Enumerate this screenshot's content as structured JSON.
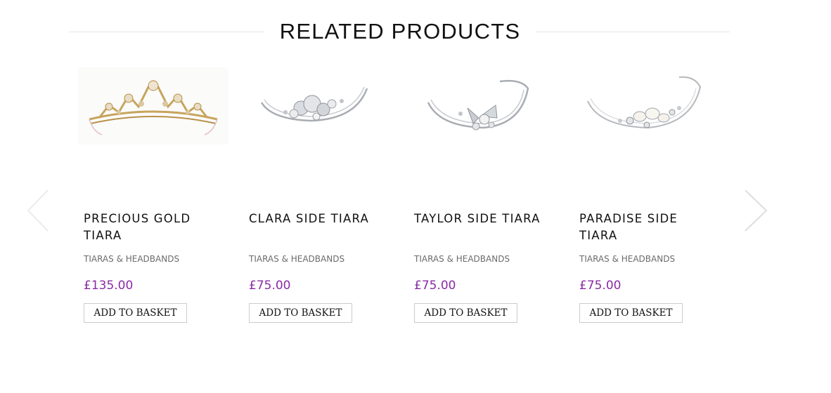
{
  "section": {
    "title": "RELATED PRODUCTS"
  },
  "carousel": {
    "prev_icon": "chevron-left-icon",
    "next_icon": "chevron-right-icon"
  },
  "products": [
    {
      "name": "PRECIOUS GOLD TIARA",
      "category": "TIARAS & HEADBANDS",
      "price": "£135.00",
      "button": "ADD TO BASKET",
      "image": "gold-tiara-image",
      "metal_color": "#c7a45c"
    },
    {
      "name": "CLARA SIDE TIARA",
      "category": "TIARAS & HEADBANDS",
      "price": "£75.00",
      "button": "ADD TO BASKET",
      "image": "silver-side-tiara-image",
      "metal_color": "#a9adb3"
    },
    {
      "name": "TAYLOR SIDE TIARA",
      "category": "TIARAS & HEADBANDS",
      "price": "£75.00",
      "button": "ADD TO BASKET",
      "image": "silver-side-tiara-image",
      "metal_color": "#a9adb3"
    },
    {
      "name": "PARADISE SIDE TIARA",
      "category": "TIARAS & HEADBANDS",
      "price": "£75.00",
      "button": "ADD TO BASKET",
      "image": "silver-pearl-tiara-image",
      "metal_color": "#b5b8bc"
    }
  ],
  "colors": {
    "price": "#8a2ba6",
    "text": "#111111",
    "category": "#6b6b6b",
    "rule": "#e6e6e6"
  }
}
